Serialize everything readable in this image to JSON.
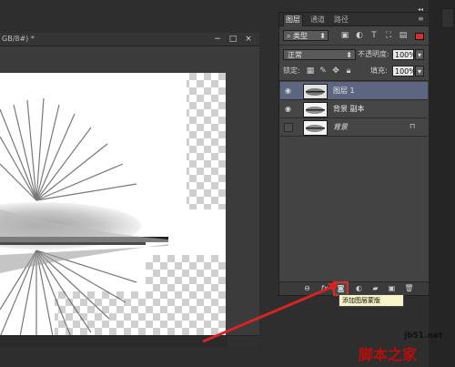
{
  "document": {
    "title": "GB/8#) *",
    "window_buttons": [
      "−",
      "□",
      "×"
    ]
  },
  "layers_panel": {
    "tabs": [
      "图层",
      "通道",
      "路径"
    ],
    "menu_glyph": "≡",
    "collapse_glyph": "◂◂",
    "filter_kind": "类型",
    "blend_mode": "正常",
    "opacity_label": "不透明度:",
    "opacity_value": "100%",
    "lock_label": "锁定:",
    "fill_label": "填充:",
    "fill_value": "100%",
    "layers": [
      {
        "name": "图层 1",
        "visible": true,
        "selected": true,
        "locked": false
      },
      {
        "name": "背景 副本",
        "visible": true,
        "selected": false,
        "locked": false
      },
      {
        "name": "背景",
        "visible": false,
        "selected": false,
        "locked": true
      }
    ]
  },
  "footer_buttons": [
    "link-layers",
    "add-layer-style",
    "add-layer-mask",
    "new-adjustment-layer",
    "new-group",
    "new-layer",
    "delete-layer"
  ],
  "tooltip": "添加图层蒙版",
  "watermark": {
    "site": "jb51.net",
    "text": "脚本之家"
  },
  "colors": {
    "panel_bg": "#434343",
    "selected_layer": "#5c6680",
    "highlight_red": "#d4302b",
    "arrow_red": "#d42424"
  }
}
